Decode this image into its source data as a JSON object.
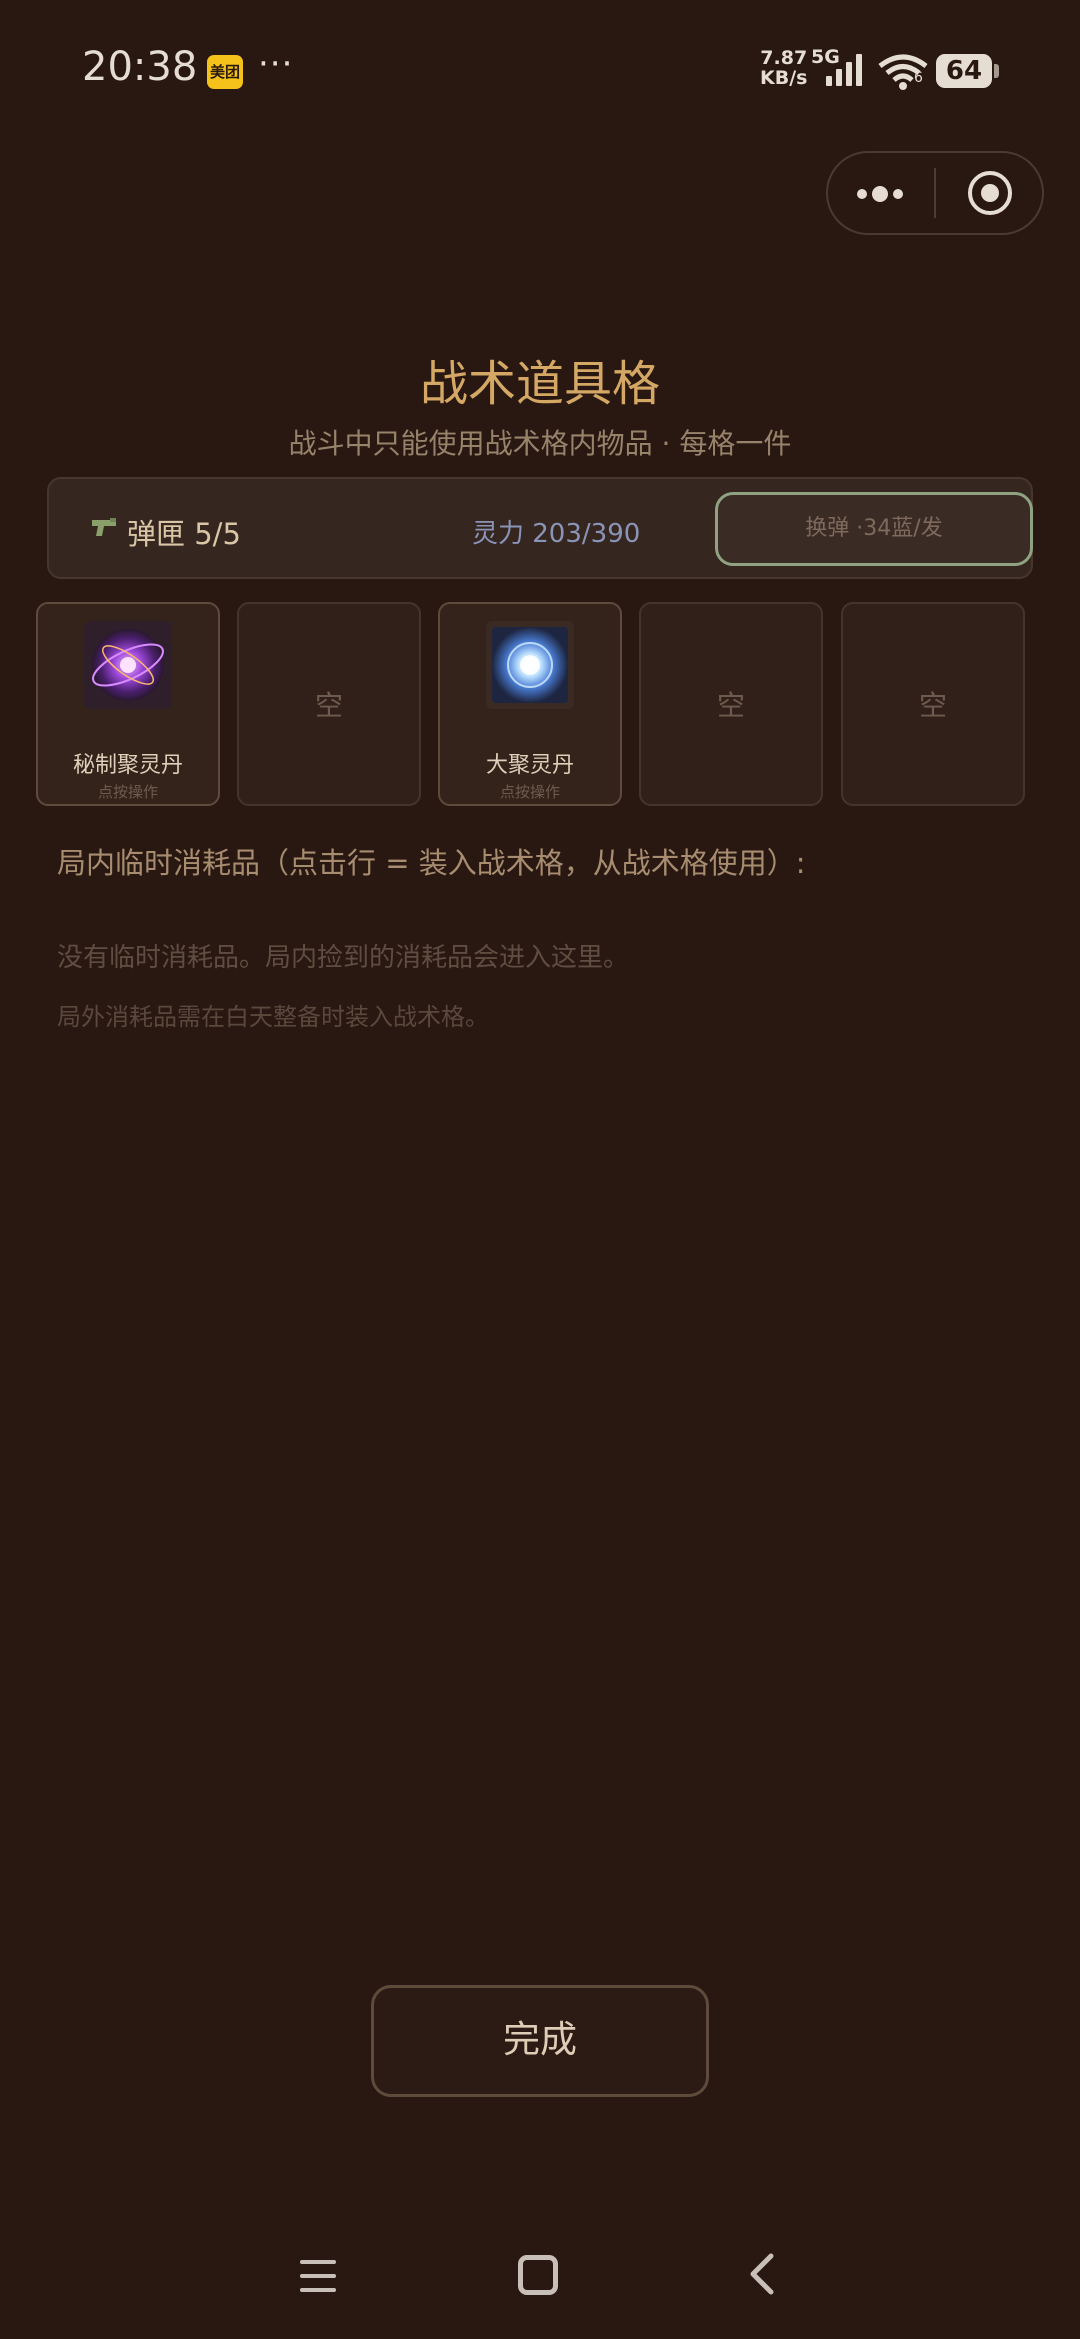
{
  "status_bar": {
    "time": "20:38",
    "app_badge": "美团",
    "more": "···",
    "net_speed_value": "7.87",
    "net_speed_unit": "KB/s",
    "network_type": "5G",
    "wifi_sub": "6",
    "battery": "64"
  },
  "header": {
    "title": "战术道具格",
    "subtitle": "战斗中只能使用战术格内物品 · 每格一件"
  },
  "top_panel": {
    "ammo": "弹匣 5/5",
    "mana": "灵力 203/390",
    "reload_label": "换弹 ·34蓝/发"
  },
  "slots": [
    {
      "name": "秘制聚灵丹",
      "hint": "点按操作",
      "icon": "purple-orb-icon"
    },
    {
      "empty": "空"
    },
    {
      "name": "大聚灵丹",
      "hint": "点按操作",
      "icon": "blue-orb-icon"
    },
    {
      "empty": "空"
    },
    {
      "empty": "空"
    }
  ],
  "consumables": {
    "label": "局内临时消耗品（点击行 = 装入战术格，从战术格使用）:",
    "empty_message": "没有临时消耗品。局内捡到的消耗品会进入这里。",
    "note": "局外消耗品需在白天整备时装入战术格。"
  },
  "done_label": "完成",
  "colors": {
    "background": "#281811",
    "title": "#d4a765",
    "reload_border": "#8fa282"
  }
}
